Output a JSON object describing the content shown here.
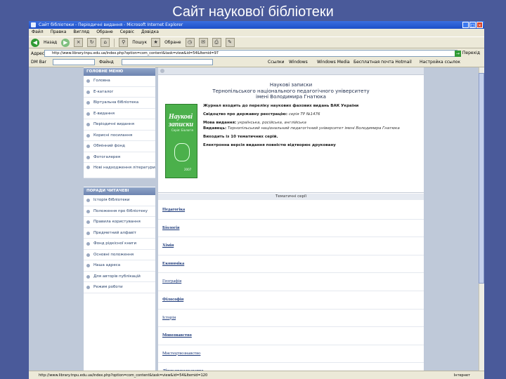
{
  "slide": {
    "title": "Сайт наукової бібліотеки"
  },
  "window": {
    "title": "Сайт бібліотеки - Періодичні видання - Microsoft Internet Explorer",
    "min": "_",
    "max": "□",
    "close": "×"
  },
  "menu": [
    "Файл",
    "Правка",
    "Вигляд",
    "Обране",
    "Сервіс",
    "Довідка"
  ],
  "toolbar": {
    "back_label": "Назад",
    "search_label": "Пошук",
    "favorites_label": "Обране"
  },
  "address": {
    "label": "Адреса:",
    "url": "http://www.library.tnpu.edu.ua/index.php?option=com_content&task=view&id=54&Itemid=97",
    "go_label": "Перехід"
  },
  "links": {
    "prefix": "DM Bar",
    "search_label": "Файнд",
    "items": [
      "Ссылки",
      "Windows",
      "Windows Media",
      "Бесплатная почта Hotmail",
      "Настройка ссылок"
    ]
  },
  "sidebar": {
    "main_menu_title": "ГОЛОВНЕ МЕНЮ",
    "main_menu": [
      "Головна",
      "Е-каталог",
      "Віртуальна бібліотека",
      "Е-видання",
      "Періодичні видання",
      "Корисні посилання",
      "Обмінний фонд",
      "Фотогалерея",
      "Нові надходження літератури"
    ],
    "reader_menu_title": "ПОРАДИ ЧИТАЧЕВІ",
    "reader_menu": [
      "Історія бібліотеки",
      "Положення про бібліотеку",
      "Правила користування",
      "Предметний алфавіт",
      "Фонд рідкісної книги",
      "Основні положення",
      "Наша адреса",
      "Для авторів публікацій",
      "Режим роботи"
    ]
  },
  "journal": {
    "title_lines": [
      "Наукові записки",
      "Тернопільського національного педагогічного університету",
      "імені Володимира Гнатюка"
    ],
    "cover_word": "Наукові записки",
    "cover_sub": "Серія: Біологія",
    "cover_year": "2007",
    "info": [
      {
        "label": "Журнал входить до переліку наукових фахових видань ВАК України",
        "value": ""
      },
      {
        "label": "Свідоцтво про державну реєстрацію:",
        "value": "серія ТР №1476"
      },
      {
        "label": "Мова видання:",
        "value": "українська, російська, англійська"
      },
      {
        "label": "Видавець:",
        "value": "Тернопільський національний педагогічний університет імені Володимира Гнатюка"
      },
      {
        "label": "Виходить із 10 тематичних серій.",
        "value": ""
      },
      {
        "label": "Електронна версія видання повністю відтворює друковану",
        "value": ""
      }
    ]
  },
  "topics": {
    "header": "Тематичні серії",
    "items": [
      "Педагогіка",
      "Біологія",
      "Хімія",
      "Економіка",
      "Географія",
      "Філософія",
      "Історія",
      "Мовознавство",
      "Мистецтвознавство",
      "Літературознавство"
    ]
  },
  "status": {
    "text": "http://www.library.tnpu.edu.ua/index.php?option=com_content&task=view&id=54&Itemid=120",
    "zone": "Інтернет"
  }
}
